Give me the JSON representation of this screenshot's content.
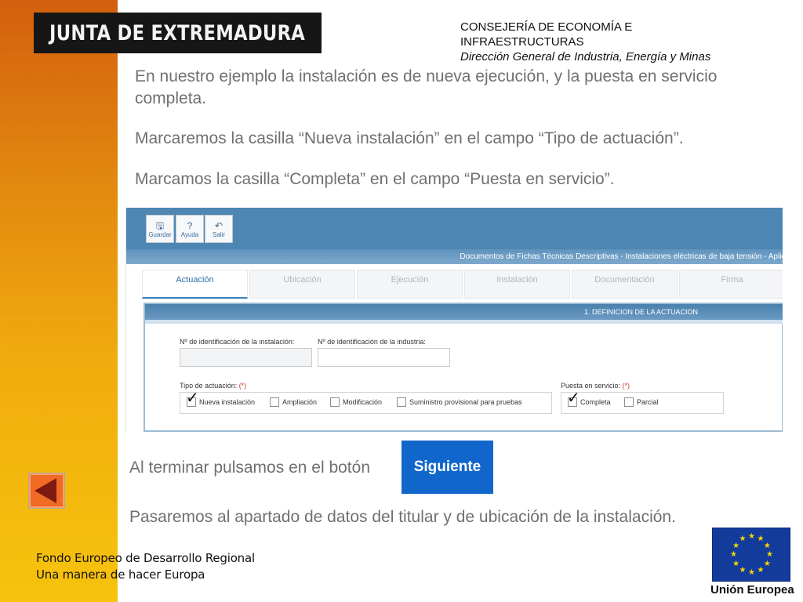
{
  "header": {
    "logo_text": "JUNTA DE EXTREMADURA",
    "dept_line1": "CONSEJERÍA DE ECONOMÍA E",
    "dept_line2": "INFRAESTRUCTURAS",
    "dept_line3": "Dirección General de Industria, Energía y Minas"
  },
  "body": {
    "para1_line1": "En nuestro ejemplo la instalación es de nueva ejecución, y la puesta en servicio",
    "para1_line2": "completa.",
    "para2": "Marcaremos la casilla “Nueva instalación” en el campo “Tipo de actuación”.",
    "para3": "Marcamos la casilla “Completa” en el campo “Puesta en servicio”.",
    "finish_text": "Al terminar pulsamos en el botón",
    "next_label": "Siguiente",
    "next_text": "Pasaremos al apartado de datos del titular y de ubicación de la instalación."
  },
  "app": {
    "toolbar": [
      {
        "label": "Guardar",
        "icon": "save-icon",
        "glyph": "🖫"
      },
      {
        "label": "Ayuda",
        "icon": "help-icon",
        "glyph": "?"
      },
      {
        "label": "Salir",
        "icon": "exit-icon",
        "glyph": "↶"
      }
    ],
    "band_title": "Documentos de Fichas Técnicas Descriptivas - Instalaciones eléctricas de baja tensión - Aplica",
    "tabs": [
      "Actuación",
      "Ubicación",
      "Ejecución",
      "Instalación",
      "Documentación",
      "Firma"
    ],
    "active_tab": "Actuación",
    "section_title": "1. DEFINICION DE LA ACTUACION",
    "id_instalacion_label": "Nº de identificación de la instalación:",
    "id_instalacion_value": "",
    "id_industria_label": "Nº de identificación de la industria:",
    "id_industria_value": "",
    "tipo_label": "Tipo de actuación:",
    "required_mark": "(*)",
    "tipo_options": [
      {
        "label": "Nueva instalación",
        "checked": true
      },
      {
        "label": "Ampliación",
        "checked": false
      },
      {
        "label": "Modificación",
        "checked": false
      },
      {
        "label": "Suministro provisional para pruebas",
        "checked": false
      }
    ],
    "puesta_label": "Puesta en servicio:",
    "puesta_options": [
      {
        "label": "Completa",
        "checked": true
      },
      {
        "label": "Parcial",
        "checked": false
      }
    ],
    "tick_glyph": "✓"
  },
  "footer": {
    "line1": "Fondo Europeo de Desarrollo Regional",
    "line2": "Una manera de hacer Europa",
    "eu_label": "Unión Europea",
    "eu_star": "★"
  },
  "colors": {
    "sidebar_top": "#d35f0e",
    "sidebar_bottom": "#f7c30c",
    "next_button": "#1166cc",
    "back_button": "#f26b24",
    "app_header": "#4d86b2",
    "eu_blue": "#123b9b",
    "eu_star": "#f5d800"
  }
}
